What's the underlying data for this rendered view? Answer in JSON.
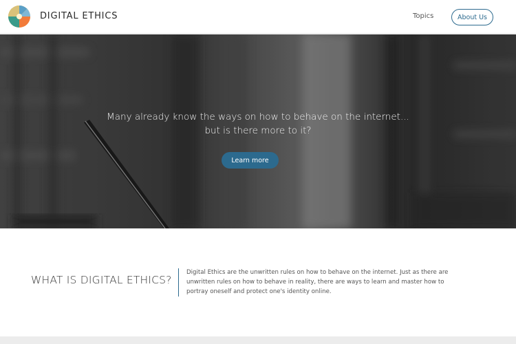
{
  "header": {
    "brand": "DIGITAL ETHICS",
    "nav": {
      "topics": "Topics",
      "about": "About Us"
    }
  },
  "hero": {
    "line1": "Many already know the ways on how to behave on the internet...",
    "line2": "but is there more to it?",
    "button": "Learn more"
  },
  "section": {
    "title": "WHAT IS DIGITAL ETHICS?",
    "body": "Digital Ethics are the unwritten rules on how to behave on the internet. Just as there are unwritten rules on how to behave in reality, there are ways to learn and master how to portray oneself and protect one's identity online."
  },
  "colors": {
    "accent": "#2c6a8e"
  }
}
